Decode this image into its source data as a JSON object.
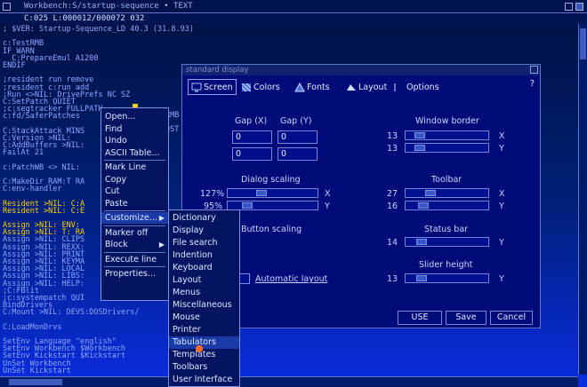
{
  "window": {
    "title": "Workbench:S/startup-sequence • TEXT",
    "status": "C:025  L:000012/000072  032"
  },
  "code_lines": [
    {
      "text": "; $VER: Startup-Sequence_LD 40.3 (31.8.93)",
      "hl": false
    },
    {
      "text": "",
      "hl": false
    },
    {
      "text": "c:TestRMB",
      "hl": false
    },
    {
      "text": "IF WARN",
      "hl": false
    },
    {
      "text": "  C:PrepareEmul A1200",
      "hl": false
    },
    {
      "text": "ENDIF",
      "hl": false
    },
    {
      "text": "",
      "hl": false
    },
    {
      "text": ";resident run remove",
      "hl": false
    },
    {
      "text": ";resident c:run add",
      "hl": false
    },
    {
      "text": ";Run <>NIL: DrivePrefs NC SZ",
      "hl": false
    },
    {
      "text": "C:SetPatch QUIET",
      "hl": false
    },
    {
      "text": ";c:segtracker FULLPATH",
      "hl": false
    },
    {
      "text": "c:fd/SaferPatches",
      "hl": false
    },
    {
      "text": "",
      "hl": false
    },
    {
      "text": "C:StackAttack MINS",
      "hl": false
    },
    {
      "text": "C:Version >NIL:",
      "hl": false
    },
    {
      "text": "C:AddBuffers >NIL:",
      "hl": false
    },
    {
      "text": "FailAt 21",
      "hl": false
    },
    {
      "text": "",
      "hl": false
    },
    {
      "text": "c:PatchWB <> NIL:",
      "hl": false
    },
    {
      "text": "",
      "hl": false
    },
    {
      "text": "C:MakeDir RAM:T RA",
      "hl": false
    },
    {
      "text": "C:env-handler",
      "hl": false
    },
    {
      "text": "",
      "hl": false
    },
    {
      "text": "Resident >NIL: C:A",
      "hl": true
    },
    {
      "text": "Resident >NIL: C:E",
      "hl": true
    },
    {
      "text": "",
      "hl": false
    },
    {
      "text": "Assign >NIL: ENV:",
      "hl": true
    },
    {
      "text": "Assign >NIL: T: RA",
      "hl": true
    },
    {
      "text": "Assign >NIL: CLIPS",
      "hl": false
    },
    {
      "text": "Assign >NIL: REXX:",
      "hl": false
    },
    {
      "text": "Assign >NIL: PRINT",
      "hl": false
    },
    {
      "text": "Assign >NIL: KEYMA",
      "hl": false
    },
    {
      "text": "Assign >NIL: LOCAL",
      "hl": false
    },
    {
      "text": "Assign >NIL: LIBS:",
      "hl": false
    },
    {
      "text": "Assign >NIL: HELP:",
      "hl": false
    },
    {
      "text": ";C:FBlit",
      "hl": false
    },
    {
      "text": ";c:systempatch QUI",
      "hl": false
    },
    {
      "text": "BindDrivers",
      "hl": false
    },
    {
      "text": "C:Mount >NIL: DEVS:DOSDrivers/",
      "hl": false
    },
    {
      "text": "",
      "hl": false
    },
    {
      "text": "C:LoadMonDrvs",
      "hl": false
    },
    {
      "text": "",
      "hl": false
    },
    {
      "text": "SetEnv Language \"english\"",
      "hl": false
    },
    {
      "text": "SetEnv Workbench $Workbench",
      "hl": false
    },
    {
      "text": "SetEnv Kickstart $Kickstart",
      "hl": false
    },
    {
      "text": "UnSet Workbench",
      "hl": false
    },
    {
      "text": "UnSet Kickstart",
      "hl": false
    }
  ],
  "code_fragments": {
    "rmb": "RMB",
    "ost": "OST"
  },
  "prefs": {
    "title": "standard display",
    "tabs": [
      {
        "label": "Screen",
        "icon": "screen-icon"
      },
      {
        "label": "Colors",
        "icon": "colors-icon"
      },
      {
        "label": "Fonts",
        "icon": "fonts-icon"
      },
      {
        "label": "Layout",
        "icon": "layout-icon"
      },
      {
        "label": "Options",
        "icon": "options-icon"
      }
    ],
    "help": "?",
    "gap_x_label": "Gap (X)",
    "gap_y_label": "Gap (Y)",
    "gap_x_values": [
      "0",
      "0"
    ],
    "gap_y_values": [
      "0",
      "0"
    ],
    "window_border_label": "Window border",
    "window_border_x": "13",
    "window_border_y": "13",
    "dialog_scaling_label": "Dialog scaling",
    "dialog_scaling_x": "127%",
    "dialog_scaling_y": "95%",
    "toolbar_label": "Toolbar",
    "toolbar_x": "27",
    "toolbar_y": "16",
    "button_scaling_label": "Button scaling",
    "status_bar_label": "Status bar",
    "status_bar_value": "14",
    "slider_height_label": "Slider height",
    "slider_height_value": "13",
    "auto_layout_label": "Automatic layout",
    "axis_x": "X",
    "axis_y": "Y",
    "buttons": {
      "use": "USE",
      "save": "Save",
      "cancel": "Cancel"
    }
  },
  "context_menu": {
    "items": [
      {
        "label": "Open...",
        "sep_after": false,
        "sub": false
      },
      {
        "label": "Find",
        "sep_after": false,
        "sub": false
      },
      {
        "label": "Undo",
        "sep_after": false,
        "sub": false
      },
      {
        "label": "ASCII Table...",
        "sep_after": true,
        "sub": false
      },
      {
        "label": "Mark Line",
        "sep_after": false,
        "sub": false
      },
      {
        "label": "Copy",
        "sep_after": false,
        "sub": false
      },
      {
        "label": "Cut",
        "sep_after": false,
        "sub": false
      },
      {
        "label": "Paste",
        "sep_after": true,
        "sub": false
      },
      {
        "label": "Customize...",
        "sep_after": true,
        "sub": true
      },
      {
        "label": "Marker off",
        "sep_after": false,
        "sub": false
      },
      {
        "label": "Block",
        "sep_after": true,
        "sub": true
      },
      {
        "label": "Execute line",
        "sep_after": true,
        "sub": false
      },
      {
        "label": "Properties...",
        "sep_after": false,
        "sub": false
      }
    ],
    "selected": "Customize..."
  },
  "sub_menu": {
    "items": [
      "Dictionary",
      "Display",
      "File search",
      "Indention",
      "Keyboard",
      "Layout",
      "Menus",
      "Miscellaneous",
      "Mouse",
      "Printer",
      "Tabulators",
      "Templates",
      "Toolbars",
      "User Interface"
    ],
    "selected": "Tabulators"
  },
  "colors": {
    "highlight": "#ffd200",
    "menu_selection": "#1a3aa8"
  }
}
